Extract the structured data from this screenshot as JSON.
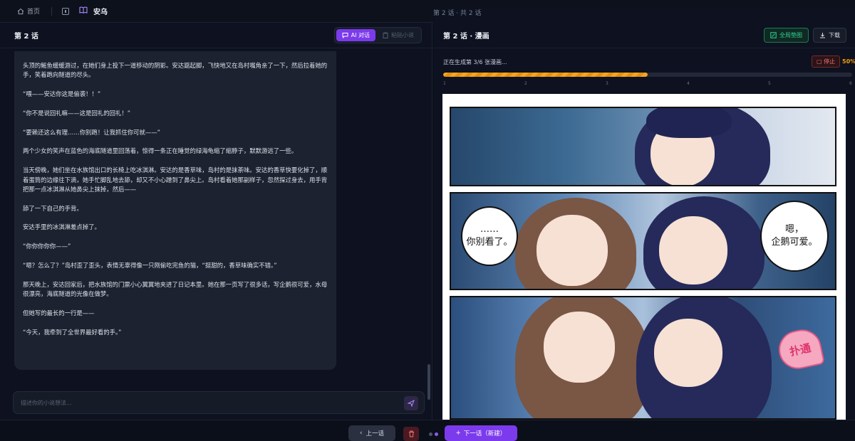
{
  "topbar": {
    "home_label": "首页",
    "title": "安乌",
    "chapter_status": "第 2 话 · 共 2 话"
  },
  "left": {
    "title": "第 2 话",
    "tabs": [
      {
        "label": "AI 对话",
        "active": true
      },
      {
        "label": "粘贴小说",
        "active": false
      }
    ],
    "paragraphs": [
      "头顶的鳐鱼缓缓游过，在她们身上投下一道移动的阴影。安达踮起脚，飞快地又在岛村嘴角亲了一下，然后拉着她的手，笑着跑向隧道的尽头。",
      "“喂——安达你这是偷袭！！”",
      "“你不是说回礼嘛——这是回礼的回礼！”",
      "“要赖还这么有理……你别跑！让我抓住你可就——”",
      "两个少女的笑声在蓝色的海底隧道里回荡着，惊得一条正在睡觉的绿海龟缩了缩脖子，默默游远了一些。",
      "当天傍晚，她们坐在水族馆出口的长椅上吃冰淇淋。安达的是香草味，岛村的是抹茶味。安达的香草快要化掉了，顺着蛋筒的边缘往下滴，她手忙脚乱地去舔，却又不小心蹭到了鼻尖上。岛村看着她那副样子，忽然探过身去，用手背把那一点冰淇淋从她鼻尖上抹掉，然后——",
      "舔了一下自己的手背。",
      "安达手里的冰淇淋差点掉了。",
      "“你你你你你——”",
      "“嗯？怎么了？”岛村歪了歪头，表情无辜得像一只刚偷吃完鱼的猫，“挺甜的，香草味确实不错。”",
      "那天晚上，安达回家后，把水族馆的门票小心翼翼地夹进了日记本里。她在那一页写了很多话，写企鹅很可爱，水母很漂亮，海底隧道的光像在做梦。",
      "但她写的最长的一行是——",
      "“今天，我牵到了全世界最好看的手。”"
    ],
    "input_placeholder": "描述你的小说想法..."
  },
  "right": {
    "title": "第 2 话 · 漫画",
    "regen_label": "全局垫图",
    "download_label": "下载",
    "progress_text": "正在生成第 3/6 张漫画...",
    "stop_label": "停止",
    "progress_value": 50,
    "progress_label": "50%",
    "steps": [
      "1",
      "2",
      "3",
      "4",
      "5",
      "6"
    ],
    "bubbles": {
      "left_line1": "……",
      "left_line2": "你别看了。",
      "right_line1": "嗯，",
      "right_line2": "企鹅可爱。",
      "heart_text": "扑通"
    }
  },
  "bottom": {
    "prev_label": "上一话",
    "next_label": "下一话（新建）"
  },
  "colors": {
    "accent": "#7c3aed",
    "progress": "#f5a524",
    "success": "#34d399",
    "danger": "#f87171"
  }
}
